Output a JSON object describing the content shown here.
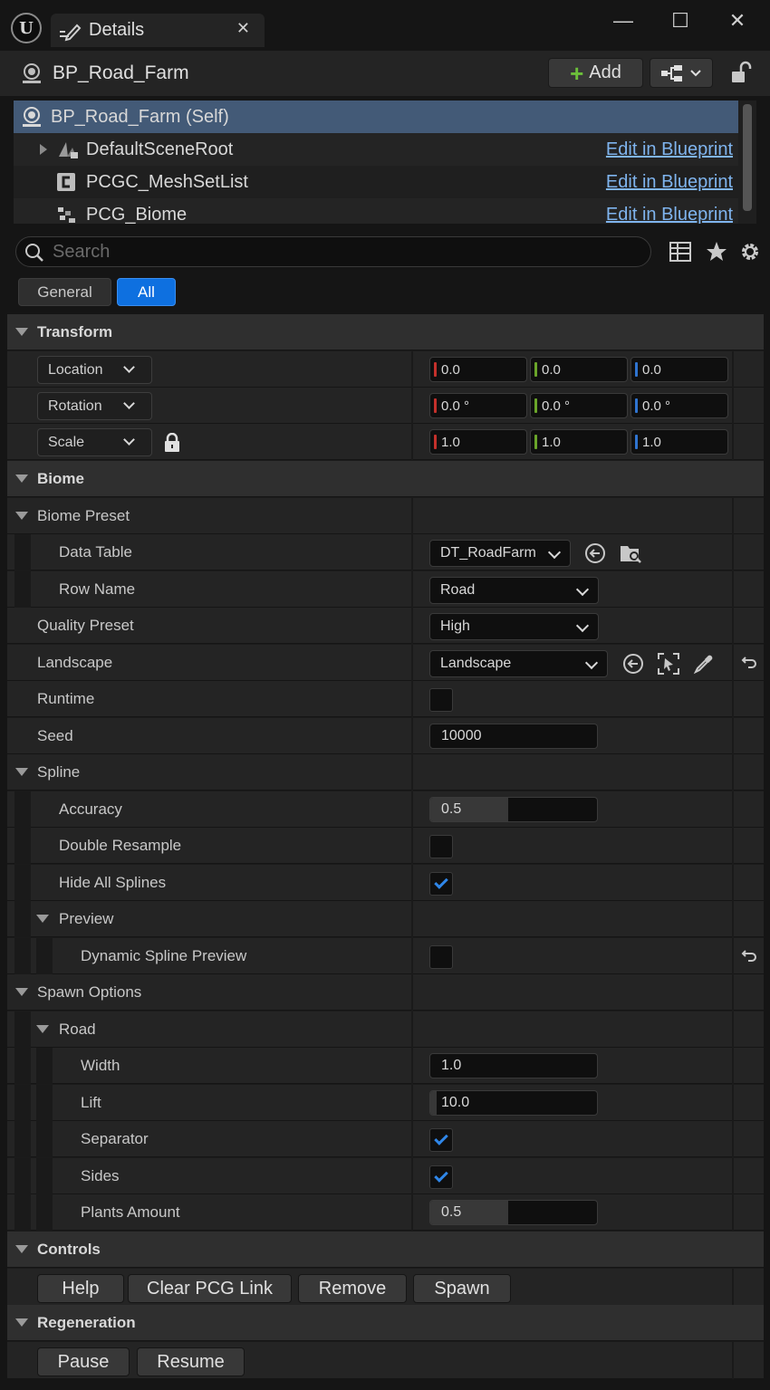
{
  "window": {
    "tab_title": "Details",
    "close_glyph": "✕",
    "minimize_glyph": "—",
    "maximize_glyph": "☐",
    "window_close_glyph": "✕"
  },
  "header": {
    "actor_name": "BP_Road_Farm",
    "add_label": "Add"
  },
  "components": [
    {
      "name": "BP_Road_Farm (Self)",
      "link": ""
    },
    {
      "name": "DefaultSceneRoot",
      "link": "Edit in Blueprint"
    },
    {
      "name": "PCGC_MeshSetList",
      "link": "Edit in Blueprint"
    },
    {
      "name": "PCG_Biome",
      "link": "Edit in Blueprint"
    }
  ],
  "search": {
    "placeholder": "Search"
  },
  "filters": {
    "general": "General",
    "all": "All"
  },
  "transform": {
    "title": "Transform",
    "location": {
      "label": "Location",
      "x": "0.0",
      "y": "0.0",
      "z": "0.0"
    },
    "rotation": {
      "label": "Rotation",
      "x": "0.0 °",
      "y": "0.0 °",
      "z": "0.0 °"
    },
    "scale": {
      "label": "Scale",
      "x": "1.0",
      "y": "1.0",
      "z": "1.0"
    }
  },
  "biome": {
    "title": "Biome",
    "preset_title": "Biome Preset",
    "data_table_label": "Data Table",
    "data_table_value": "DT_RoadFarm",
    "row_name_label": "Row Name",
    "row_name_value": "Road",
    "quality_label": "Quality Preset",
    "quality_value": "High",
    "landscape_label": "Landscape",
    "landscape_value": "Landscape",
    "runtime_label": "Runtime",
    "runtime_checked": false,
    "seed_label": "Seed",
    "seed_value": "10000"
  },
  "spline": {
    "title": "Spline",
    "accuracy_label": "Accuracy",
    "accuracy_value": "0.5",
    "accuracy_fraction": 0.47,
    "double_resample_label": "Double Resample",
    "double_resample_checked": false,
    "hide_all_label": "Hide All Splines",
    "hide_all_checked": true,
    "preview_title": "Preview",
    "dynamic_preview_label": "Dynamic Spline Preview",
    "dynamic_preview_checked": false
  },
  "spawn": {
    "title": "Spawn Options",
    "road_title": "Road",
    "width_label": "Width",
    "width_value": "1.0",
    "lift_label": "Lift",
    "lift_value": "10.0",
    "lift_fraction": 0.04,
    "separator_label": "Separator",
    "separator_checked": true,
    "sides_label": "Sides",
    "sides_checked": true,
    "plants_label": "Plants Amount",
    "plants_value": "0.5",
    "plants_fraction": 0.47
  },
  "controls": {
    "title": "Controls",
    "help": "Help",
    "clear": "Clear PCG Link",
    "remove": "Remove",
    "spawn": "Spawn"
  },
  "regeneration": {
    "title": "Regeneration",
    "pause": "Pause",
    "resume": "Resume"
  },
  "colors": {
    "accent": "#0e70e0",
    "link": "#7fb4ee",
    "x_axis": "#c4302b",
    "y_axis": "#6aa52a",
    "z_axis": "#2f74d0",
    "selection": "#435a77"
  }
}
